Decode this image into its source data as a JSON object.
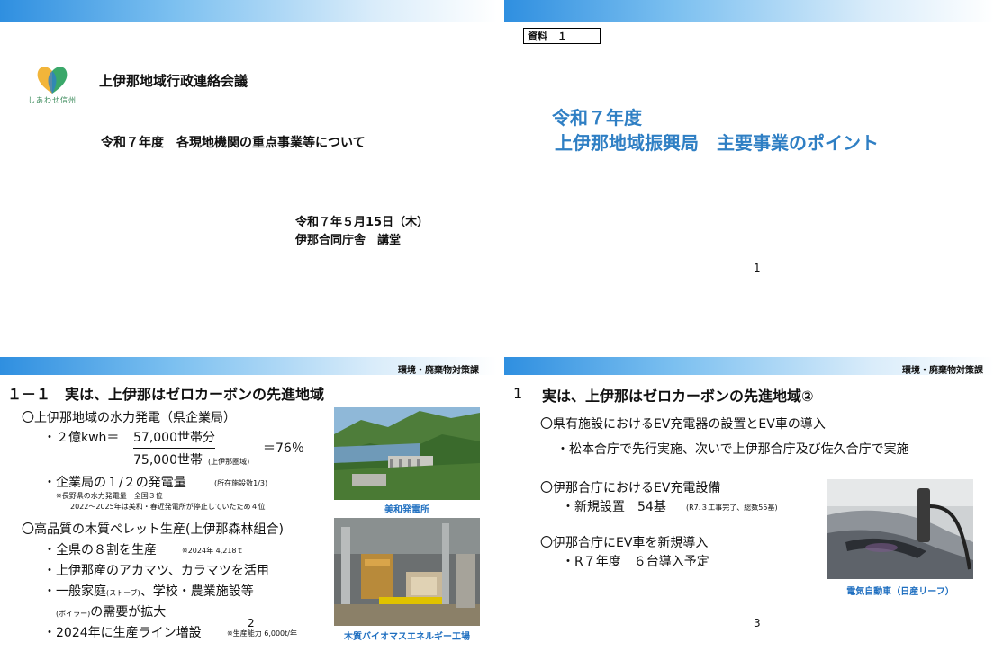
{
  "slide1": {
    "logo_text": "しあわせ信州",
    "meeting_name": "上伊那地域行政連絡会議",
    "subject": "令和７年度　各現地機関の重点事業等について",
    "date": "令和７年５月15日（木）",
    "venue": "伊那合同庁舎　講堂"
  },
  "slide2": {
    "doc_label": "資料　１",
    "title_line1": "令和７年度",
    "title_line2": "上伊那地域振興局　主要事業のポイント",
    "page_number": "1",
    "title_color": "#2f7fc4"
  },
  "slide3": {
    "dept": "環境・廃棄物対策課",
    "heading": "１－１　実は、上伊那はゼロカーボンの先進地域",
    "hydro_title": "〇上伊那地域の水力発電（県企業局）",
    "hydro_calc_prefix": "・２億kwh＝",
    "hydro_numerator": "57,000世帯分",
    "hydro_denominator": "75,000世帯",
    "hydro_denominator_note": "(上伊那圏域)",
    "hydro_ratio": "＝76％",
    "hydro_share": "・企業局の１/２の発電量",
    "hydro_share_note": "(所在施設数1/3)",
    "hydro_rank_note1": "※長野県の水力発電量　全国３位",
    "hydro_rank_note2": "2022～2025年は美和・春近発電所が停止していたため４位",
    "pellet_title": "〇高品質の木質ペレット生産(上伊那森林組合)",
    "pellet_item1": "・全県の８割を生産",
    "pellet_item1_note": "※2024年 4,218ｔ",
    "pellet_item2": "・上伊那産のアカマツ、カラマツを活用",
    "pellet_item3a": "・一般家庭",
    "pellet_item3a_note": "(ストーブ)",
    "pellet_item3b": "、学校・農業施設等",
    "pellet_item3c_note": "(ボイラー)",
    "pellet_item3c": "の需要が拡大",
    "pellet_item4": "・2024年に生産ライン増設",
    "pellet_item4_note": "※生産能力 6,000t/年",
    "photo1_caption": "美和発電所",
    "photo2_caption": "木質バイオマスエネルギー工場",
    "page_number": "2"
  },
  "slide4": {
    "dept": "環境・廃棄物対策課",
    "heading_num": "1",
    "heading": "実は、上伊那はゼロカーボンの先進地域②",
    "item1_title": "〇県有施設におけるEV充電器の設置とEV車の導入",
    "item1_sub": "・松本合庁で先行実施、次いで上伊那合庁及び佐久合庁で実施",
    "item2_title": "〇伊那合庁におけるEV充電設備",
    "item2_sub": "・新規設置　54基",
    "item2_note": "(R7.３工事完了、総数55基)",
    "item3_title": "〇伊那合庁にEV車を新規導入",
    "item3_sub": "・R７年度　６台導入予定",
    "photo_caption": "電気自動車（日産リーフ）",
    "page_number": "3"
  },
  "colors": {
    "header_bar": "#2f8fe0",
    "caption_blue": "#1f6fc0"
  }
}
